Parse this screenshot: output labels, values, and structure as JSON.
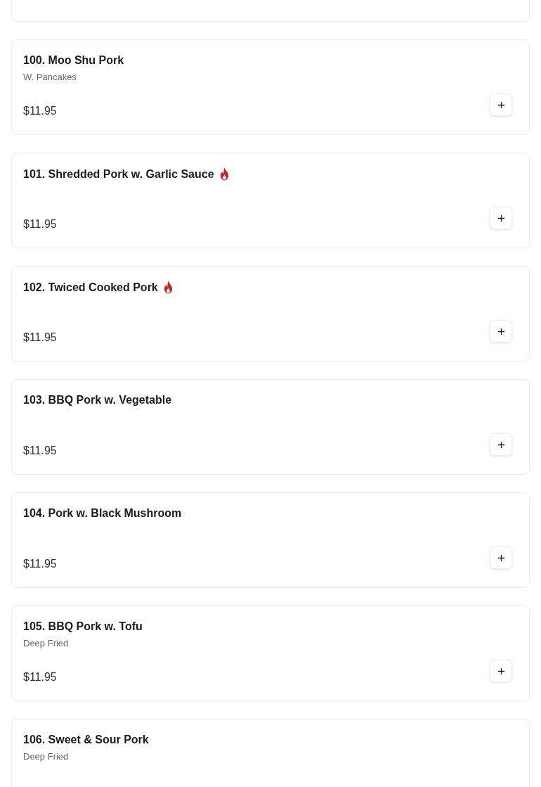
{
  "items": [
    {
      "title": "100. Moo Shu Pork",
      "description": "W. Pancakes",
      "spicy": false,
      "price": "$11.95"
    },
    {
      "title": "101. Shredded Pork w. Garlic Sauce",
      "spicy": true,
      "price": "$11.95"
    },
    {
      "title": "102. Twiced Cooked Pork",
      "spicy": true,
      "price": "$11.95"
    },
    {
      "title": "103. BBQ Pork w. Vegetable",
      "spicy": false,
      "price": "$11.95"
    },
    {
      "title": "104. Pork w. Black Mushroom",
      "spicy": false,
      "price": "$11.95"
    },
    {
      "title": "105. BBQ Pork w. Tofu",
      "description": "Deep Fried",
      "spicy": false,
      "price": "$11.95"
    },
    {
      "title": "106. Sweet & Sour Pork",
      "description": "Deep Fried",
      "spicy": false
    }
  ]
}
